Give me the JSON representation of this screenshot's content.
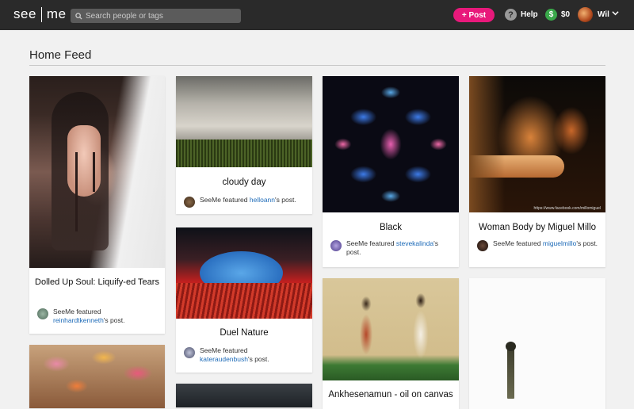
{
  "app": {
    "logo_left": "see",
    "logo_right": "me",
    "search_placeholder": "Search people or tags",
    "post_label": "+ Post",
    "help_label": "Help",
    "balance": "$0",
    "user_name": "Wil",
    "icons": {
      "search": "search-icon",
      "help": "question-icon",
      "money": "dollar-icon",
      "chevron": "chevron-down-icon"
    }
  },
  "feed": {
    "title": "Home Feed",
    "featured_prefix": "SeeMe featured",
    "featured_suffix": "'s post.",
    "cards": [
      {
        "title": "Dolled Up Soul: Liquify-ed Tears",
        "user": "reinhardtkenneth"
      },
      {
        "title": "cloudy day",
        "user": "helloann"
      },
      {
        "title": "Duel Nature",
        "user": "kateraudenbush"
      },
      {
        "title": "Black",
        "user": "stevekalinda"
      },
      {
        "title": "Woman Body by Miguel Millo",
        "user": "miguelmillo",
        "watermark": "https://www.facebook.com/millomiguel"
      },
      {
        "title": "Ankhesenamun - oil on canvas",
        "user": ""
      }
    ]
  },
  "colors": {
    "topbar": "#2a2a2a",
    "accent": "#e8197b",
    "link": "#1e6bb8",
    "money": "#3aa84a"
  }
}
